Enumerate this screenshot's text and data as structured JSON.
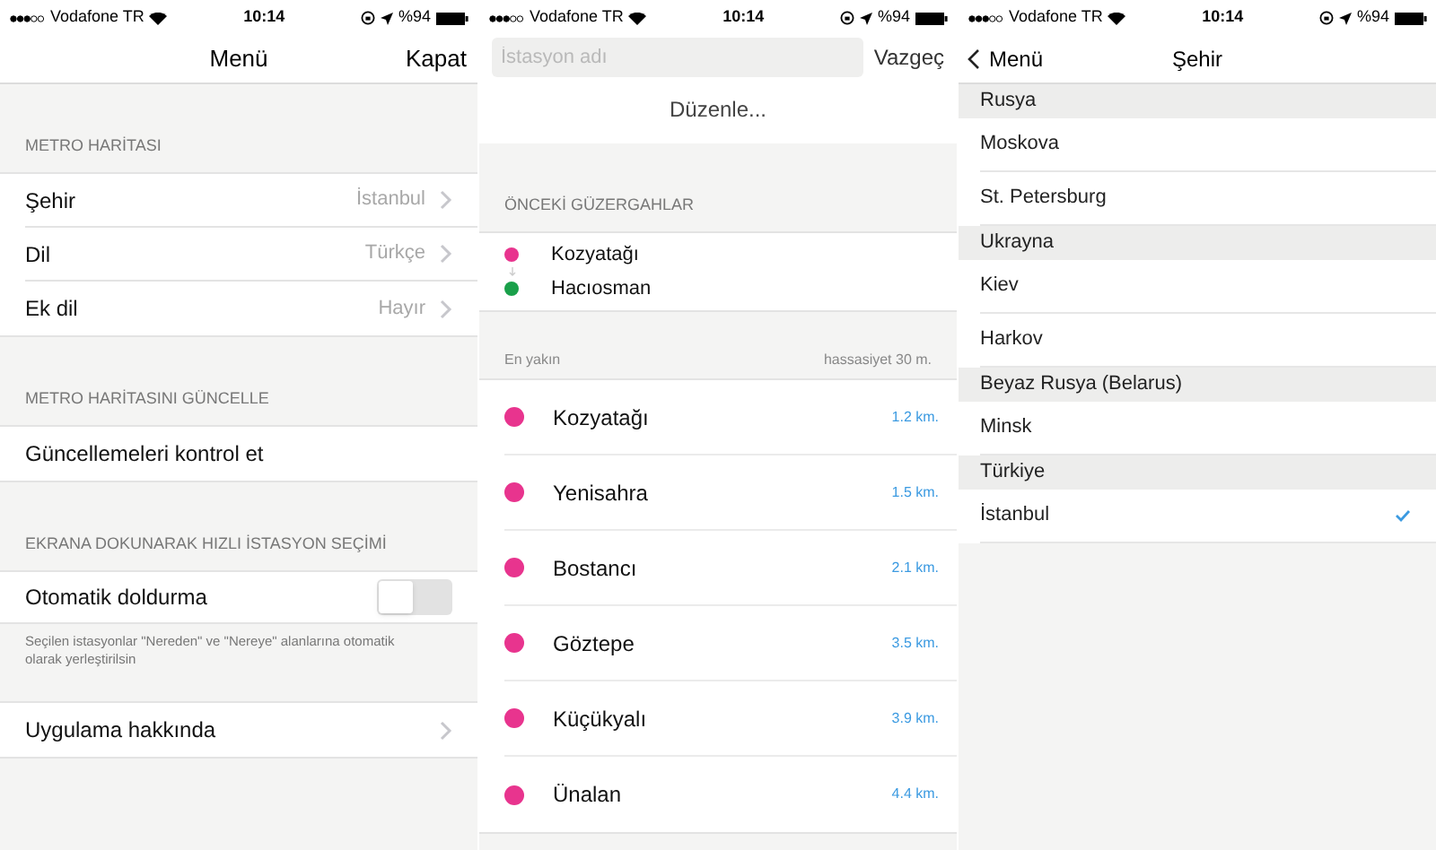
{
  "screens": [
    {
      "status_bar": {
        "carrier": "Vodafone TR",
        "time": "10:14",
        "battery": "%94"
      },
      "nav": {
        "title": "Menü",
        "right": "Kapat"
      },
      "sections": [
        {
          "header": "METRO HARİTASI",
          "rows": [
            {
              "kind": "detail",
              "label": "Şehir",
              "value": "İstanbul"
            },
            {
              "kind": "detail",
              "label": "Dil",
              "value": "Türkçe"
            },
            {
              "kind": "detail",
              "label": "Ek dil",
              "value": "Hayır"
            }
          ]
        },
        {
          "header": "METRO HARİTASINI GÜNCELLE",
          "rows": [
            {
              "kind": "plain",
              "label": "Güncellemeleri kontrol et"
            }
          ]
        },
        {
          "header": "EKRANA DOKUNARAK HIZLI İSTASYON SEÇİMİ",
          "rows": [
            {
              "kind": "toggle",
              "label": "Otomatik doldurma",
              "on": false
            }
          ],
          "footer": "Seçilen istasyonlar \"Nereden\" ve \"Nereye\" alanlarına otomatik olarak yerleştirilsin"
        },
        {
          "rows": [
            {
              "kind": "disclosure",
              "label": "Uygulama hakkında"
            }
          ]
        }
      ]
    },
    {
      "status_bar": {
        "carrier": "Vodafone TR",
        "time": "10:14",
        "battery": "%94"
      },
      "search": {
        "placeholder": "İstasyon adı",
        "cancel": "Vazgeç"
      },
      "edit": "Düzenle...",
      "previous_routes": {
        "header": "ÖNCEKİ GÜZERGAHLAR",
        "stops": [
          {
            "name": "Kozyatağı",
            "color": "#e8348e"
          },
          {
            "name": "Hacıosman",
            "color": "#1aa04a"
          }
        ]
      },
      "nearest": {
        "header": "En yakın",
        "accuracy": "hassasiyet 30 m.",
        "stations": [
          {
            "name": "Kozyatağı",
            "distance": "1.2 km.",
            "color": "#e8348e"
          },
          {
            "name": "Yenisahra",
            "distance": "1.5 km.",
            "color": "#e8348e"
          },
          {
            "name": "Bostancı",
            "distance": "2.1 km.",
            "color": "#e8348e"
          },
          {
            "name": "Göztepe",
            "distance": "3.5 km.",
            "color": "#e8348e"
          },
          {
            "name": "Küçükyalı",
            "distance": "3.9 km.",
            "color": "#e8348e"
          },
          {
            "name": "Ünalan",
            "distance": "4.4 km.",
            "color": "#e8348e"
          }
        ]
      }
    },
    {
      "status_bar": {
        "carrier": "Vodafone TR",
        "time": "10:14",
        "battery": "%94"
      },
      "nav": {
        "back": "Menü",
        "title": "Şehir"
      },
      "countries": [
        {
          "name": "Rusya",
          "cities": [
            {
              "name": "Moskova",
              "selected": false
            },
            {
              "name": "St. Petersburg",
              "selected": false
            }
          ]
        },
        {
          "name": "Ukrayna",
          "cities": [
            {
              "name": "Kiev",
              "selected": false
            },
            {
              "name": "Harkov",
              "selected": false
            }
          ]
        },
        {
          "name": "Beyaz Rusya (Belarus)",
          "cities": [
            {
              "name": "Minsk",
              "selected": false
            }
          ]
        },
        {
          "name": "Türkiye",
          "cities": [
            {
              "name": "İstanbul",
              "selected": true
            }
          ]
        }
      ]
    }
  ]
}
